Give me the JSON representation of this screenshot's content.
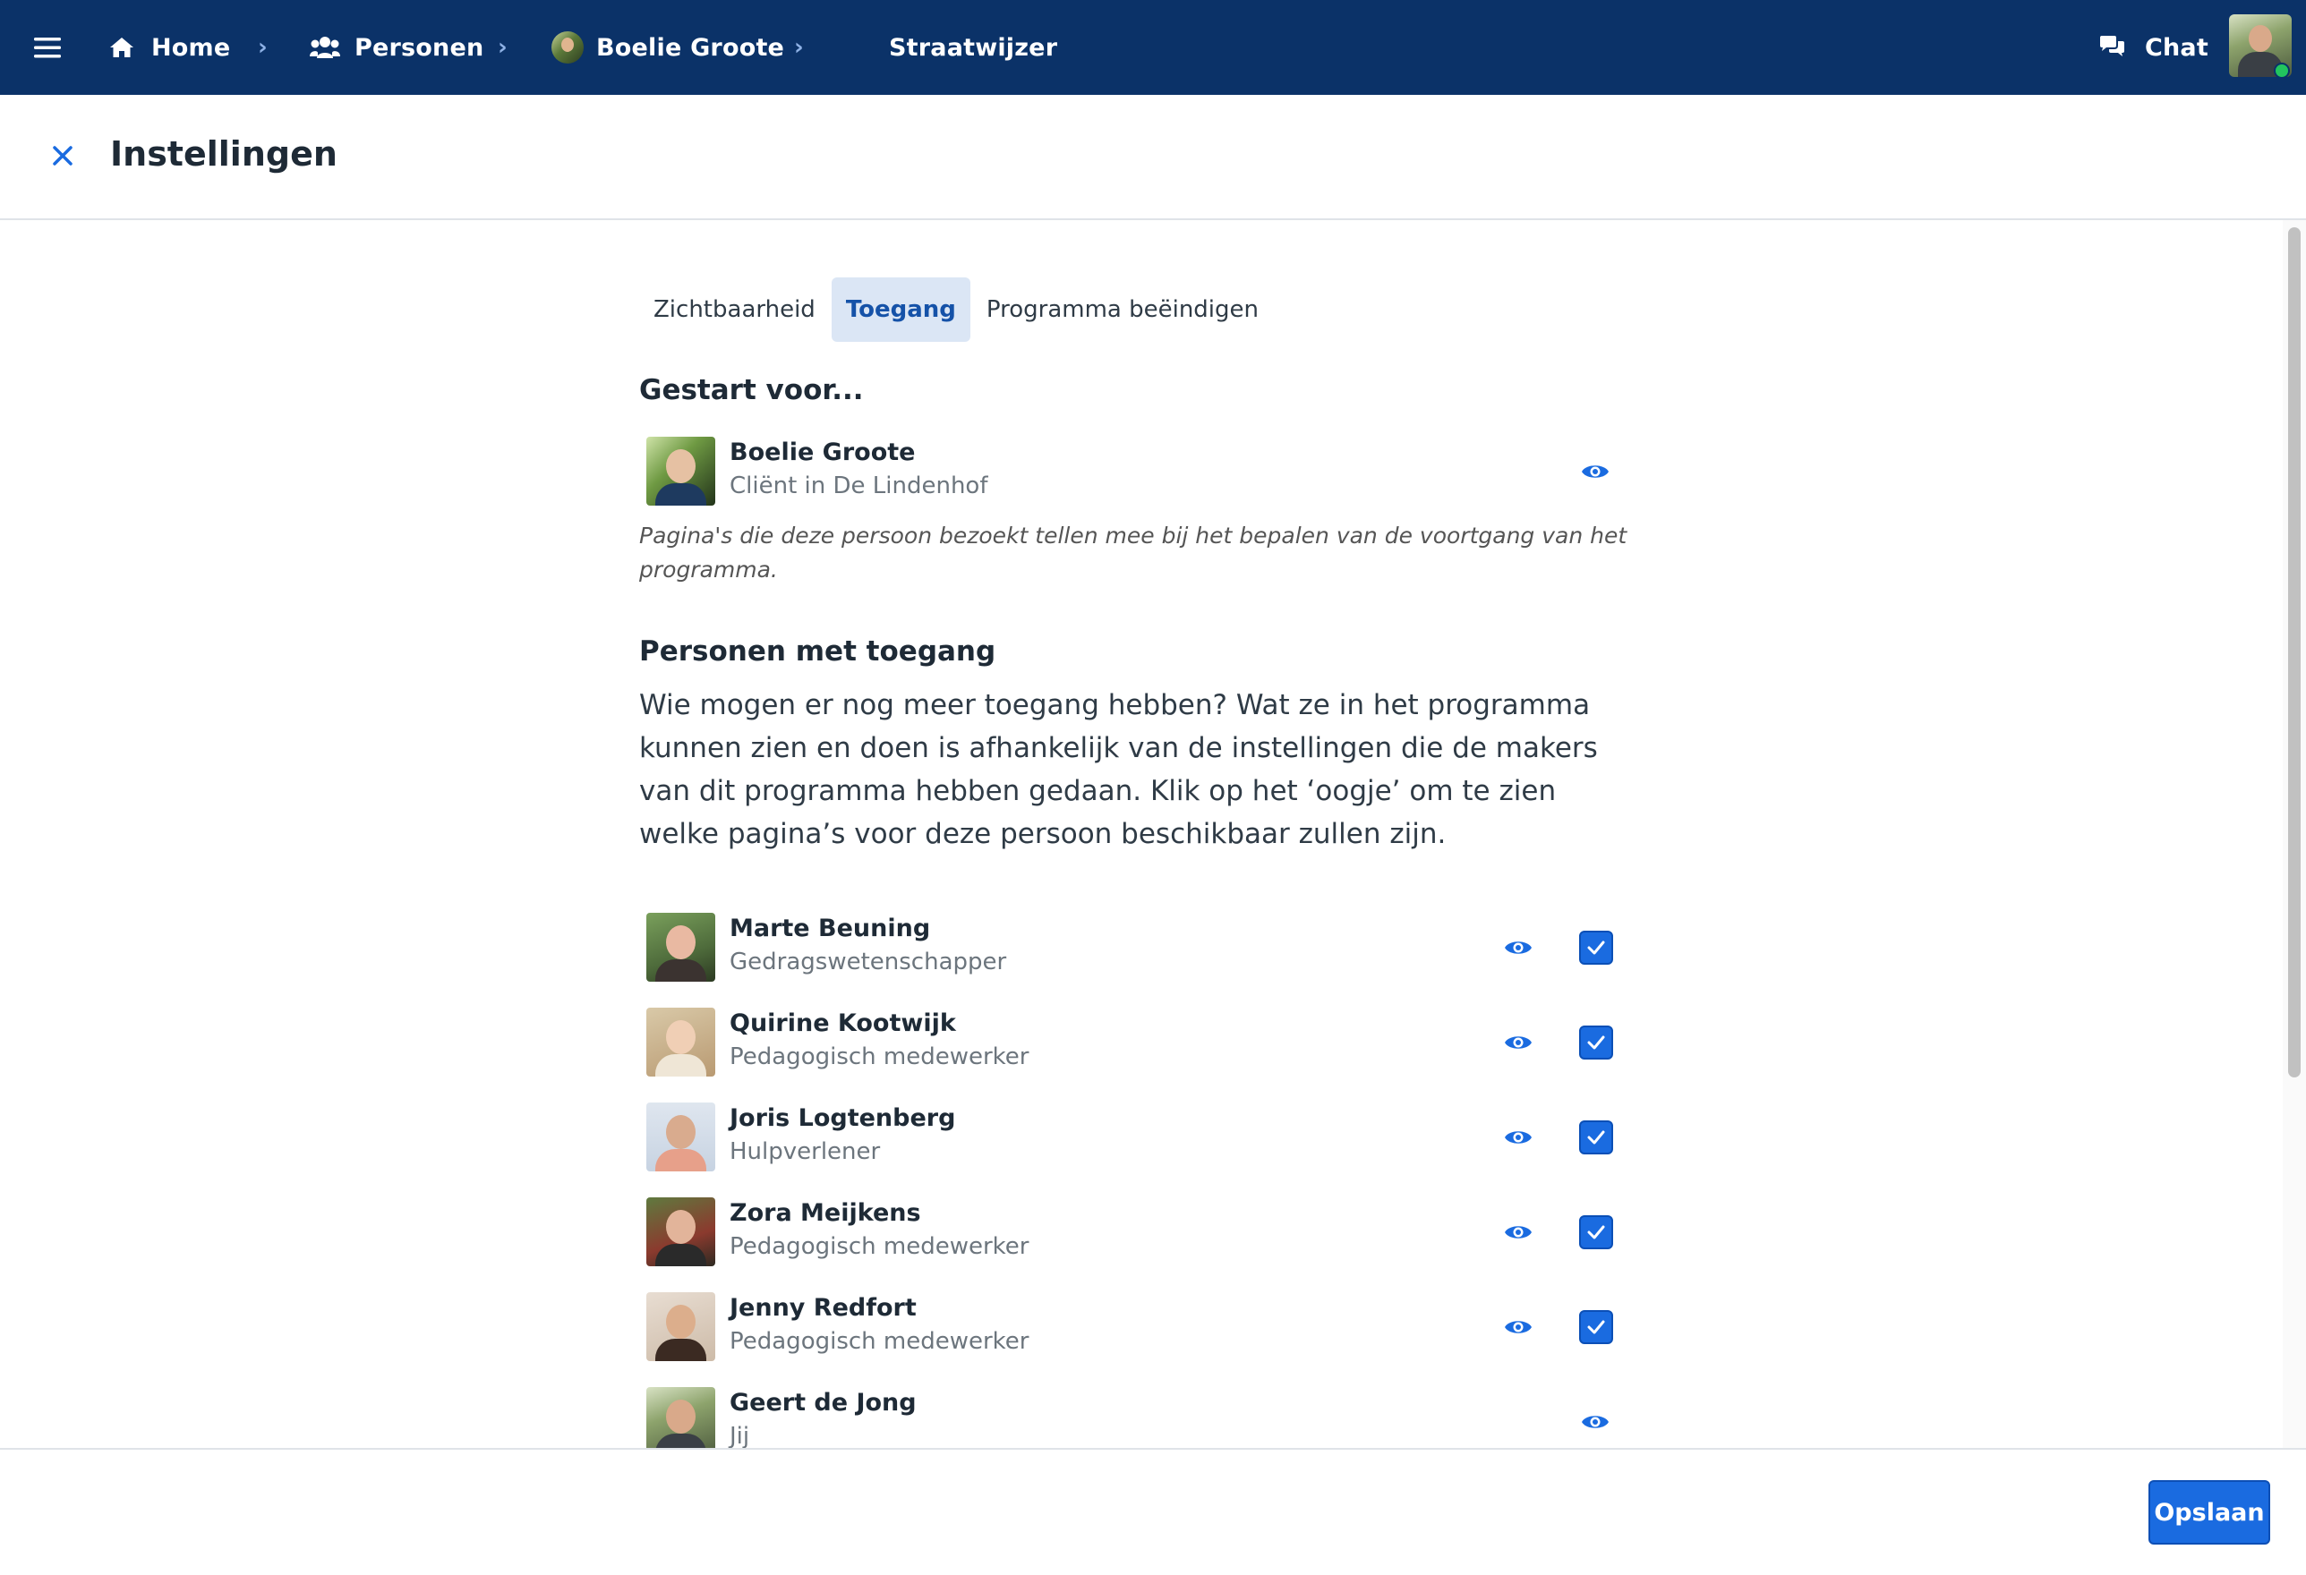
{
  "nav": {
    "home_label": "Home",
    "persons_label": "Personen",
    "client_label": "Boelie Groote",
    "current_label": "Straatwijzer",
    "chat_label": "Chat",
    "icons": [
      "menu-icon",
      "home-icon",
      "users-icon",
      "chevron-right-icon",
      "chat-icon"
    ]
  },
  "header": {
    "title": "Instellingen"
  },
  "tabs": [
    {
      "label": "Zichtbaarheid",
      "active": false
    },
    {
      "label": "Toegang",
      "active": true
    },
    {
      "label": "Programma beëindigen",
      "active": false
    }
  ],
  "started_for": {
    "heading": "Gestart voor...",
    "person": {
      "name": "Boelie Groote",
      "role": "Cliënt in De Lindenhof"
    },
    "note": "Pagina's die deze persoon bezoekt tellen mee bij het bepalen van de voortgang van het programma."
  },
  "access": {
    "heading": "Personen met toegang",
    "description": "Wie mogen er nog meer toegang hebben? Wat ze in het programma kunnen zien en doen is afhankelijk van de instellingen die de makers van dit programma hebben gedaan. Klik op het ‘oogje’ om te zien welke pagina’s voor deze persoon beschikbaar zullen zijn.",
    "people": [
      {
        "name": "Marte Beuning",
        "role": "Gedragswetenschapper",
        "checked": true
      },
      {
        "name": "Quirine Kootwijk",
        "role": "Pedagogisch medewerker",
        "checked": true
      },
      {
        "name": "Joris Logtenberg",
        "role": "Hulpverlener",
        "checked": true
      },
      {
        "name": "Zora Meijkens",
        "role": "Pedagogisch medewerker",
        "checked": true
      },
      {
        "name": "Jenny Redfort",
        "role": "Pedagogisch medewerker",
        "checked": true
      },
      {
        "name": "Geert de Jong",
        "role": "Jij",
        "checked": false
      }
    ]
  },
  "footer": {
    "save_label": "Opslaan"
  },
  "colors": {
    "navbar": "#0b3268",
    "primary": "#1a6be0",
    "tab_active_bg": "#dbe6f5",
    "online": "#22c55e"
  }
}
